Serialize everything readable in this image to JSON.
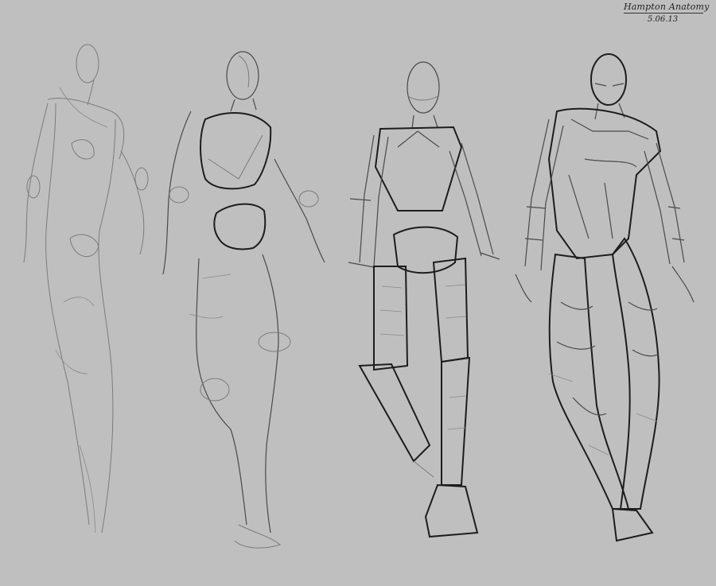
{
  "sketch": {
    "background_color": "#bfbfbf",
    "line_color": "#1d1d1d",
    "signature": {
      "title": "Hampton Anatomy",
      "date": "5.06.13"
    },
    "figures": [
      {
        "name": "gesture"
      },
      {
        "name": "mannequin-rough"
      },
      {
        "name": "mannequin-boxes"
      },
      {
        "name": "muscle-forms"
      }
    ]
  }
}
